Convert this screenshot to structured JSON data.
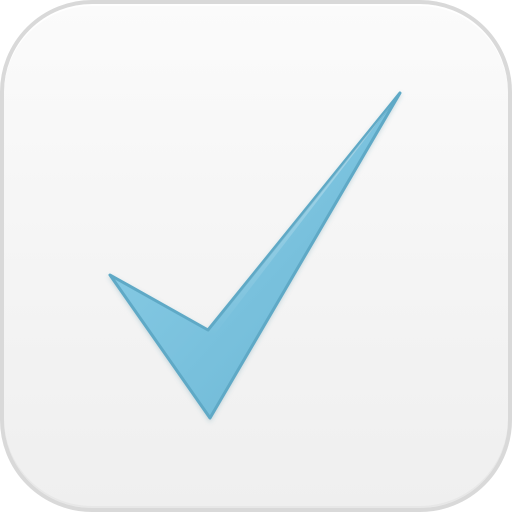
{
  "app_icon": {
    "name": "checkmark-app-icon",
    "tile_color": "#f6f6f6",
    "border_color": "#d9d9d9",
    "glyph": "checkmark-icon",
    "accent_color": "#7cc4df",
    "accent_edge_color": "#5ea9c6"
  }
}
